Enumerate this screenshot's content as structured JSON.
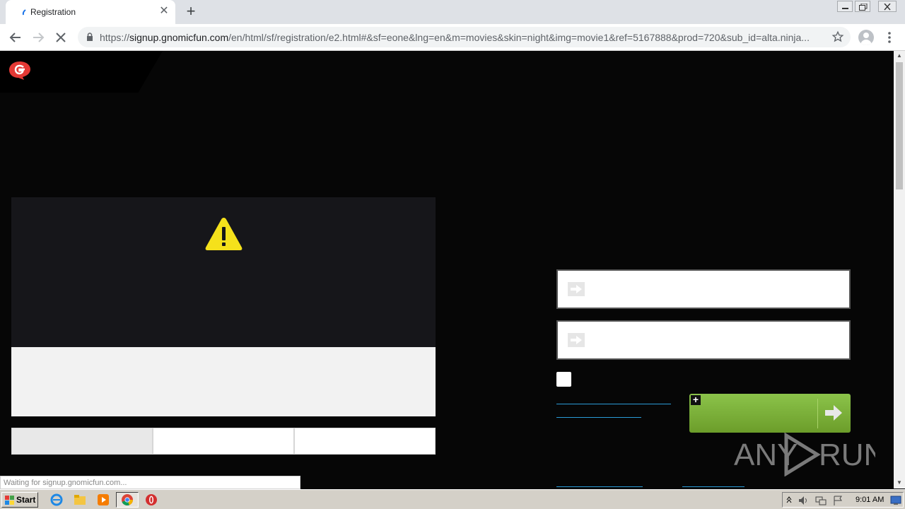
{
  "browser": {
    "tab_title": "Registration",
    "tab_close_glyph": "✕",
    "new_tab_glyph": "+",
    "url_scheme": "https://",
    "url_host": "signup.gnomicfun.com",
    "url_path": "/en/html/sf/registration/e2.html#&sf=eone&lng=en&m=movies&skin=night&img=movie1&ref=5167888&prod=720&sub_id=alta.ninja...",
    "status_text": "Waiting for signup.gnomicfun.com..."
  },
  "page": {
    "checkbox_checked": false,
    "plus_glyph": "+"
  },
  "watermark": {
    "text_left": "ANY",
    "text_right": "RUN"
  },
  "taskbar": {
    "start_label": "Start",
    "clock": "9:01 AM"
  },
  "colors": {
    "page_bg": "#060606",
    "warning_yellow": "#f5e11b",
    "button_green": "#7cb342",
    "link_blue": "#2a9bd6"
  }
}
